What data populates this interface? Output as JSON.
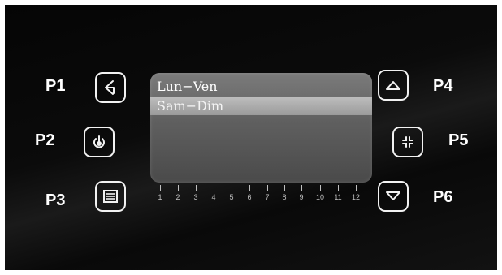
{
  "labels": {
    "p1": "P1",
    "p2": "P2",
    "p3": "P3",
    "p4": "P4",
    "p5": "P5",
    "p6": "P6"
  },
  "buttons": {
    "p1": {
      "icon": "back-arrow-icon"
    },
    "p2": {
      "icon": "power-icon"
    },
    "p3": {
      "icon": "menu-list-icon"
    },
    "p4": {
      "icon": "arrow-up-icon"
    },
    "p5": {
      "icon": "focus-corners-icon"
    },
    "p6": {
      "icon": "arrow-down-icon"
    }
  },
  "screen": {
    "menu": [
      {
        "label": "Lun−Ven",
        "selected": false
      },
      {
        "label": "Sam−Dim",
        "selected": true
      }
    ]
  },
  "hours": [
    "1",
    "2",
    "3",
    "4",
    "5",
    "6",
    "7",
    "8",
    "9",
    "10",
    "11",
    "12"
  ],
  "colors": {
    "panel": "#0a0a0a",
    "screen": "#6a6a6a",
    "highlight": "#aaaaaa",
    "text": "#ffffff"
  }
}
